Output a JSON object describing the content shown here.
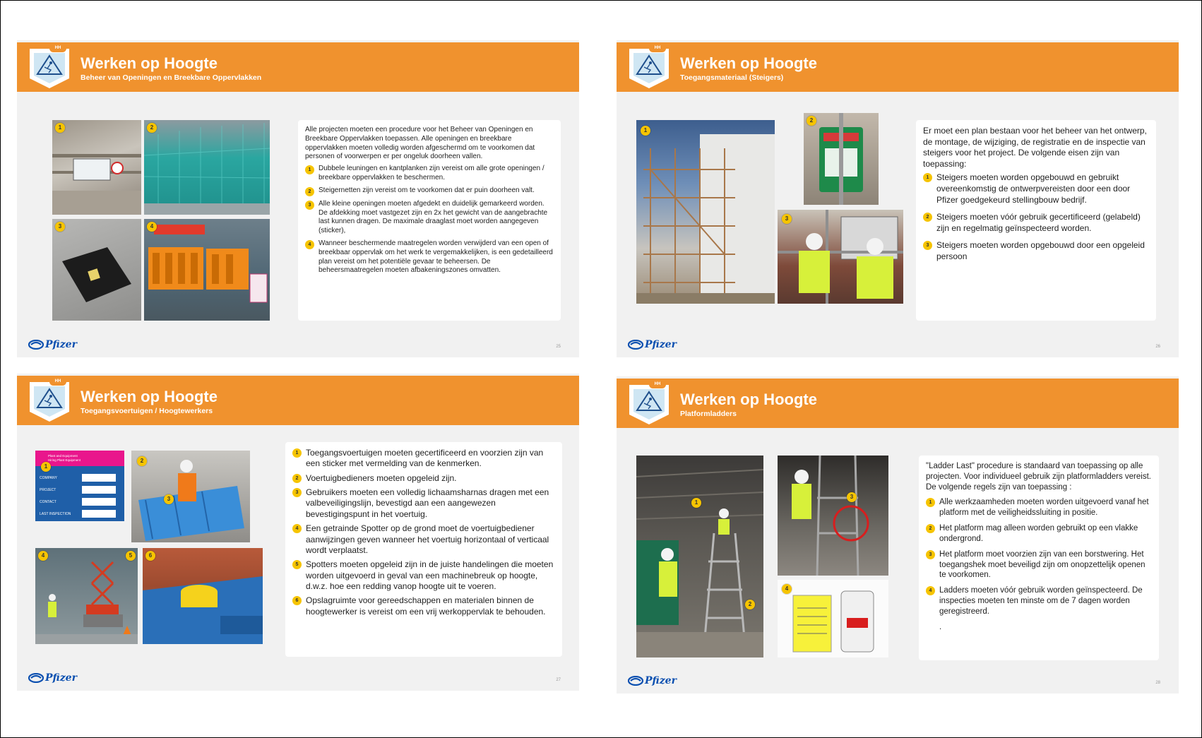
{
  "slides": [
    {
      "title": "Werken op Hoogte",
      "subtitle": "Beheer van Openingen en Breekbare Oppervlakken",
      "badge": "HH",
      "page": "25",
      "logo": "Pfizer",
      "intro": "Alle projecten moeten een procedure voor het Beheer van Openingen en Breekbare Oppervlakken toepassen. Alle openingen en breekbare oppervlakken moeten volledig worden afgeschermd om te voorkomen dat personen of voorwerpen er per ongeluk doorheen vallen.",
      "bullets": [
        {
          "n": "1",
          "text": "Dubbele leuningen en kantplanken zijn vereist om alle grote openingen / breekbare oppervlakken te beschermen."
        },
        {
          "n": "2",
          "text": "Steigernetten zijn vereist om te voorkomen dat er puin doorheen valt."
        },
        {
          "n": "3",
          "text": "Alle kleine openingen moeten afgedekt en duidelijk gemarkeerd worden. De afdekking moet vastgezet zijn en 2x het gewicht van de aangebrachte last kunnen dragen. De maximale draaglast moet worden aangegeven (sticker),"
        },
        {
          "n": "4",
          "text": "Wanneer beschermende maatregelen worden verwijderd van een open of breekbaar oppervlak om het werk te vergemakkelijken, is een gedetailleerd plan vereist om het potentiële gevaar te beheersen. De beheersmaatregelen moeten afbakeningszones omvatten."
        }
      ],
      "photo_tags": [
        "1",
        "2",
        "3",
        "4"
      ]
    },
    {
      "title": "Werken op Hoogte",
      "subtitle": "Toegangsmateriaal (Steigers)",
      "badge": "HH",
      "page": "26",
      "logo": "Pfizer",
      "intro": "Er moet een plan bestaan voor het beheer van het ontwerp, de montage, de wijziging, de registratie en de inspectie van steigers voor het project. De volgende eisen zijn van toepassing:",
      "bullets": [
        {
          "n": "1",
          "text": "Steigers moeten worden opgebouwd en gebruikt overeenkomstig de ontwerpvereisten door een door Pfizer goedgekeurd stellingbouw bedrijf."
        },
        {
          "n": "2",
          "text": "Steigers moeten vóór gebruik gecertificeerd (gelabeld) zijn en regelmatig geïnspecteerd worden."
        },
        {
          "n": "3",
          "text": "Steigers moeten worden opgebouwd door een opgeleid persoon"
        }
      ],
      "photo_tags": [
        "1",
        "2",
        "3"
      ]
    },
    {
      "title": "Werken op Hoogte",
      "subtitle": "Toegangsvoertuigen / Hoogtewerkers",
      "badge": "HH",
      "page": "27",
      "logo": "Pfizer",
      "bullets": [
        {
          "n": "1",
          "text": "Toegangsvoertuigen moeten gecertificeerd en voorzien zijn van een sticker met vermelding van de kenmerken."
        },
        {
          "n": "2",
          "text": "Voertuigbedieners moeten opgeleid zijn."
        },
        {
          "n": "3",
          "text": "Gebruikers moeten een volledig lichaamsharnas dragen met een valbeveiligingslijn, bevestigd aan een aangewezen bevestigingspunt in het voertuig."
        },
        {
          "n": "4",
          "text": "Een getrainde Spotter op de grond moet de voertuigbediener aanwijzingen geven wanneer het voertuig horizontaal of verticaal wordt verplaatst."
        },
        {
          "n": "5",
          "text": "Spotters moeten opgeleid zijn in de juiste handelingen die moeten worden uitgevoerd in geval van een machinebreuk op hoogte, d.w.z. hoe een redding vanop hoogte uit te voeren."
        },
        {
          "n": "6",
          "text": "Opslagruimte voor gereedschappen en materialen binnen de hoogtewerker is vereist om een vrij werkoppervlak te behouden."
        }
      ],
      "card": {
        "header_line1": "Plant and Equipment",
        "header_line2": "Hiring Plant Equipment",
        "fields": [
          "COMPANY",
          "PROJECT",
          "CONTACT",
          "LAST INSPECTION"
        ]
      },
      "photo_tags": [
        "1",
        "2",
        "3",
        "4",
        "5",
        "6"
      ]
    },
    {
      "title": "Werken op Hoogte",
      "subtitle": "Platformladders",
      "badge": "HH",
      "page": "28",
      "logo": "Pfizer",
      "intro": "\"Ladder Last\" procedure is standaard van toepassing op alle projecten. Voor individueel gebruik zijn platformladders vereist. De volgende regels zijn van toepassing :",
      "bullets": [
        {
          "n": "1",
          "text": "Alle werkzaamheden moeten worden uitgevoerd vanaf het platform met de veiligheidssluiting in positie."
        },
        {
          "n": "2",
          "text": "Het platform mag alleen worden gebruikt op een vlakke ondergrond."
        },
        {
          "n": "3",
          "text": "Het platform moet voorzien zijn van een borstwering. Het toegangshek moet beveiligd zijn om onopzettelijk openen te voorkomen."
        },
        {
          "n": "4",
          "text": "Ladders moeten vóór gebruik worden geïnspecteerd. De inspecties moeten ten minste om de 7 dagen worden geregistreerd."
        }
      ],
      "trailing": ".",
      "photo_tags": [
        "1",
        "2",
        "3",
        "4"
      ]
    }
  ],
  "colors": {
    "header": "#f0922e",
    "pin": "#f6c400",
    "logo": "#0a4fb0",
    "slide_bg": "#f1f1f1"
  },
  "icons": {
    "badge": "fall-hazard-icon",
    "logo": "pfizer-pill-icon"
  }
}
